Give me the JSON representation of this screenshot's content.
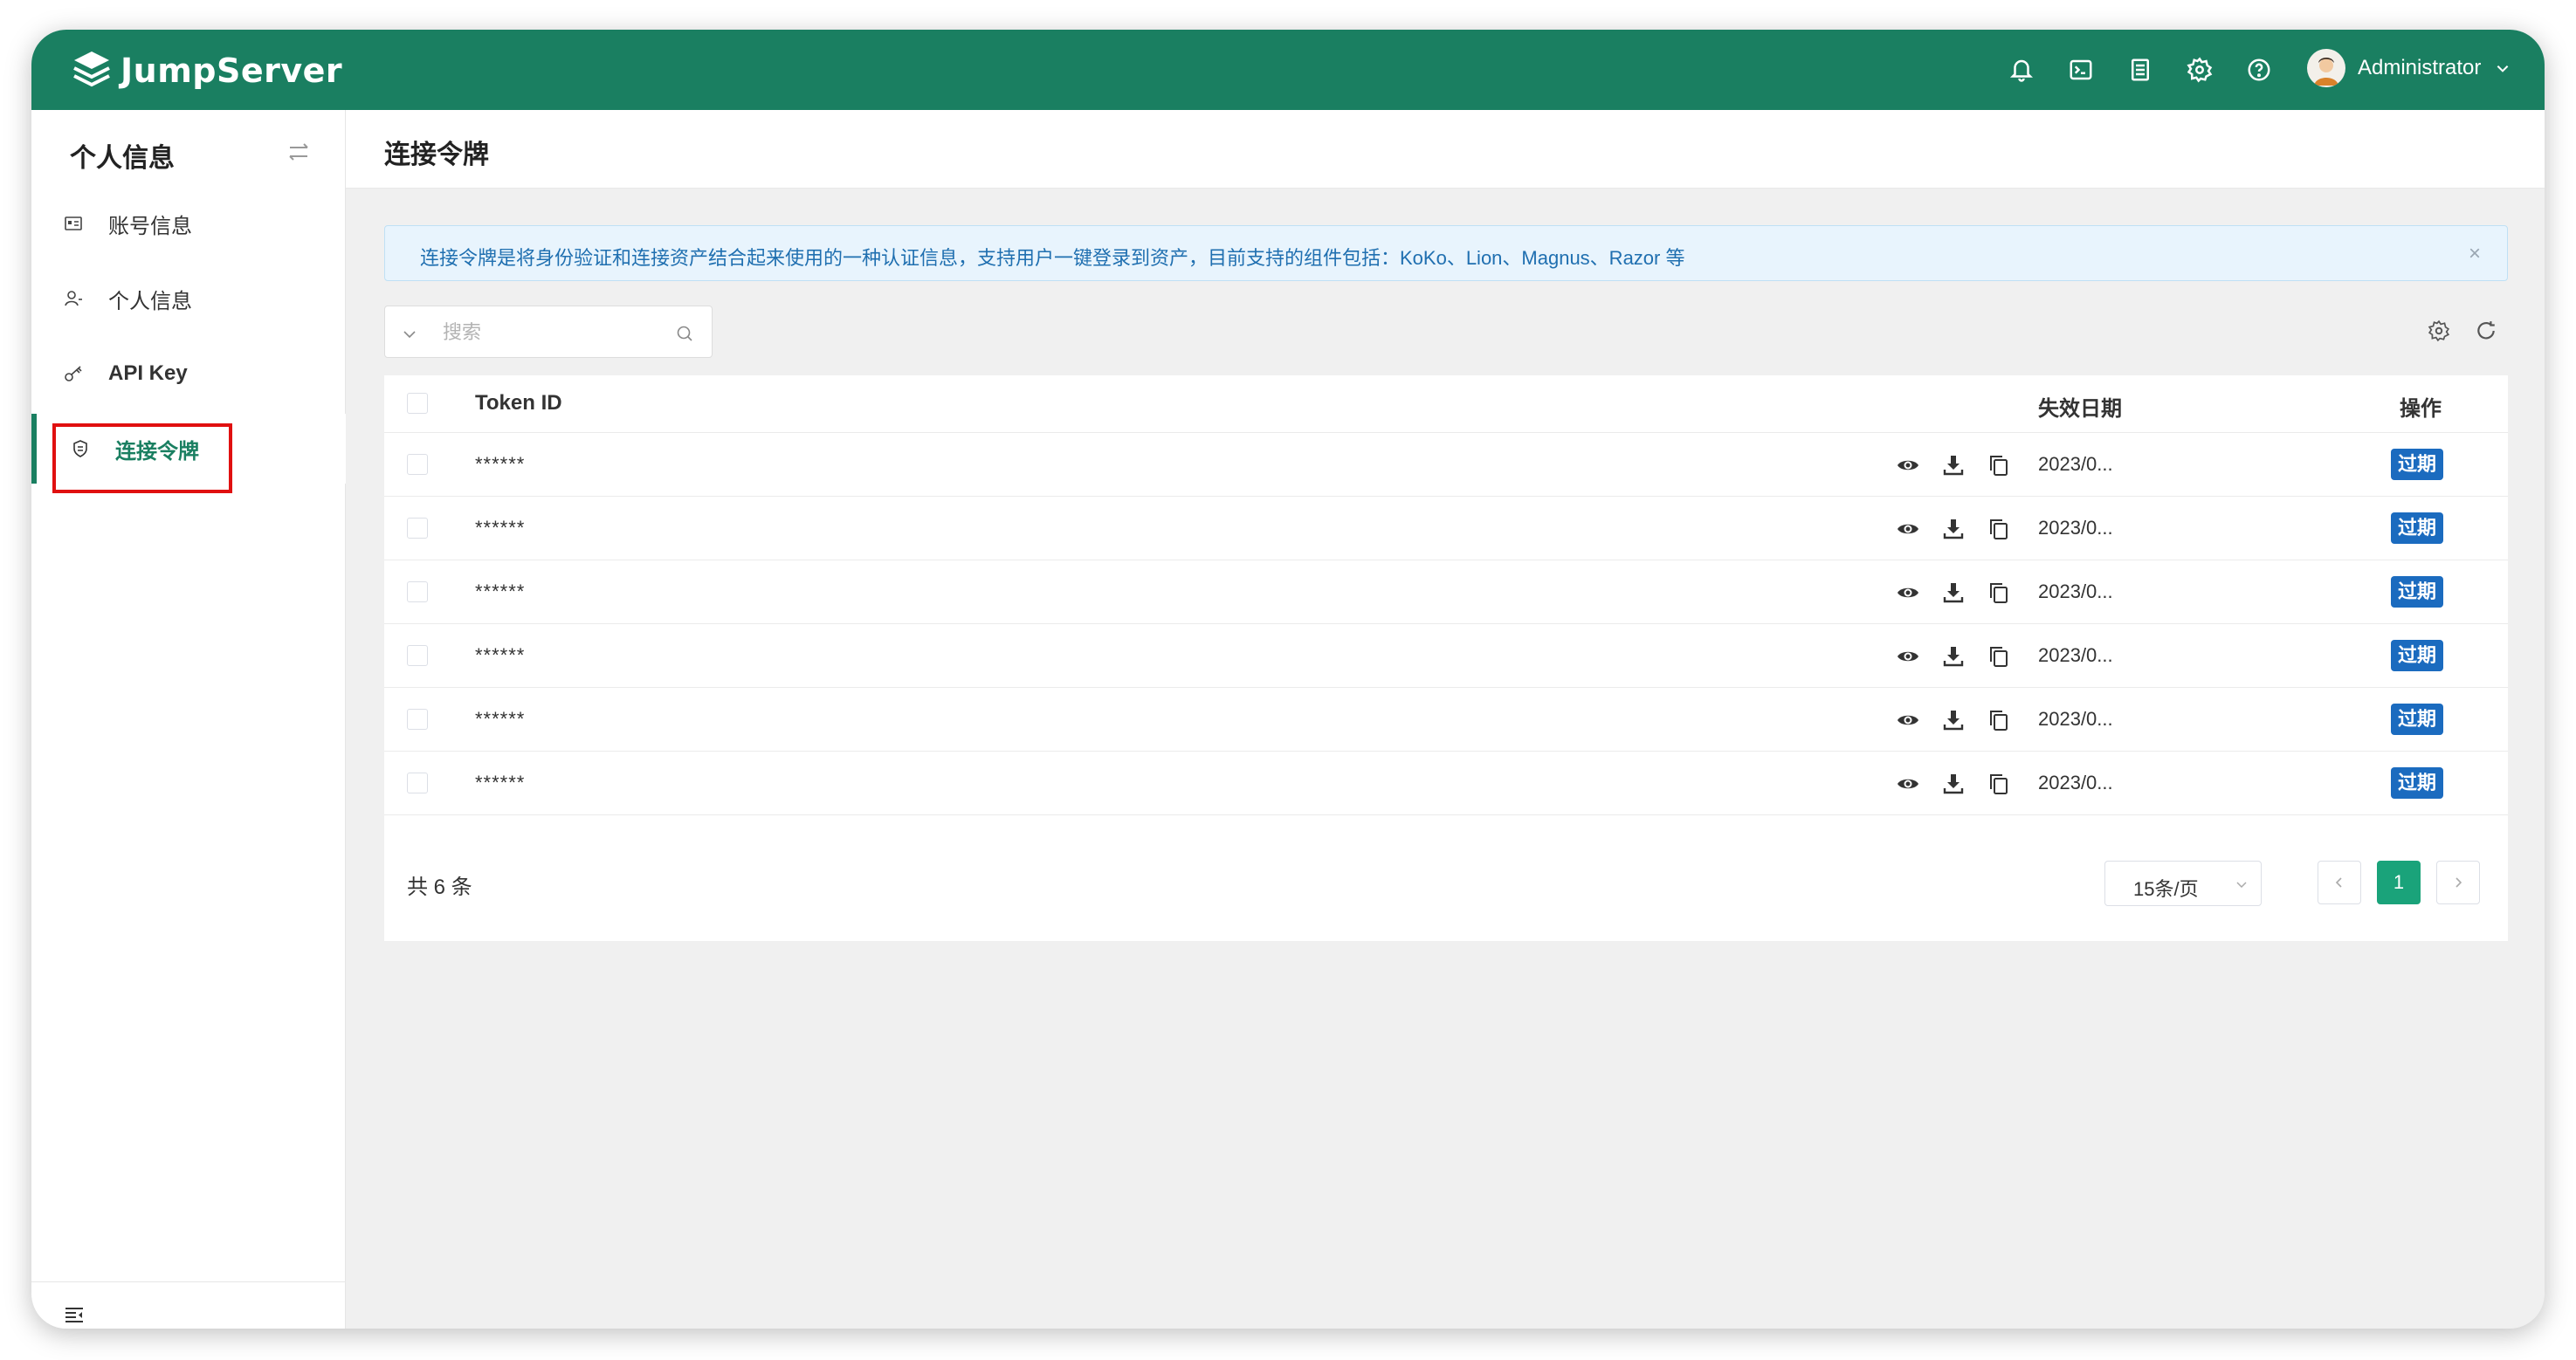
{
  "app": {
    "brand": "JumpServer",
    "brand_color": "#1a7f61"
  },
  "topbar": {
    "icons": [
      "bell-icon",
      "terminal-icon",
      "notes-icon",
      "gear-icon",
      "help-icon"
    ],
    "user_name": "Administrator"
  },
  "sidebar": {
    "title": "个人信息",
    "items": [
      {
        "label": "账号信息",
        "icon": "id-card-icon"
      },
      {
        "label": "个人信息",
        "icon": "user-icon"
      },
      {
        "label": "API Key",
        "icon": "key-icon"
      },
      {
        "label": "连接令牌",
        "icon": "shield-icon",
        "active": true
      }
    ]
  },
  "page": {
    "title": "连接令牌"
  },
  "alert": {
    "text": "连接令牌是将身份验证和连接资产结合起来使用的一种认证信息，支持用户一键登录到资产，目前支持的组件包括：KoKo、Lion、Magnus、Razor 等",
    "close": "×"
  },
  "search": {
    "placeholder": "搜索"
  },
  "table": {
    "columns": {
      "token_id": "Token ID",
      "expire": "失效日期",
      "action": "操作"
    },
    "rows": [
      {
        "token": "******",
        "expire": "2023/0...",
        "action": "过期"
      },
      {
        "token": "******",
        "expire": "2023/0...",
        "action": "过期"
      },
      {
        "token": "******",
        "expire": "2023/0...",
        "action": "过期"
      },
      {
        "token": "******",
        "expire": "2023/0...",
        "action": "过期"
      },
      {
        "token": "******",
        "expire": "2023/0...",
        "action": "过期"
      },
      {
        "token": "******",
        "expire": "2023/0...",
        "action": "过期"
      }
    ]
  },
  "pagination": {
    "total": "共 6 条",
    "page_size": "15条/页",
    "current": "1"
  }
}
